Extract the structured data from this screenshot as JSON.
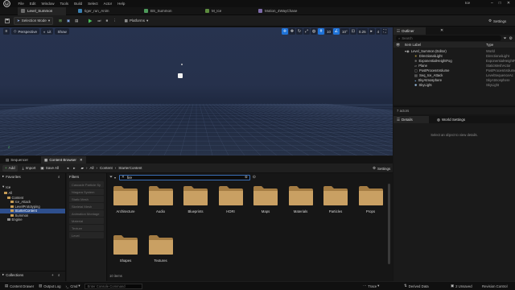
{
  "menu": {
    "items": [
      "File",
      "Edit",
      "Window",
      "Tools",
      "Build",
      "Select",
      "Actor",
      "Help"
    ]
  },
  "window": {
    "project": "Ice"
  },
  "tabs": [
    {
      "label": "Level_Summon",
      "active": true
    },
    {
      "label": "tiger_run_Anim",
      "active": false
    },
    {
      "label": "BS_Summon",
      "active": false
    },
    {
      "label": "M_Ice",
      "active": false
    },
    {
      "label": "Motion_4WayChase",
      "active": false
    }
  ],
  "toolbar": {
    "selection_mode": "Selection Mode",
    "platforms": "Platforms",
    "settings": "Settings"
  },
  "viewport": {
    "perspective": "Perspective",
    "lit": "Lit",
    "show": "Show",
    "grid_snap": "10",
    "rotation_snap": "10°",
    "scale_snap": "0.25",
    "camera_speed": "4",
    "axis_label": "Z"
  },
  "outliner": {
    "tab": "Outliner",
    "search_placeholder": "Search",
    "col_label": "Item Label",
    "col_type": "Type",
    "rows": [
      {
        "label": "Level_Summon (Editor)",
        "type": "World"
      },
      {
        "label": "DirectionalLight",
        "type": "DirectionalLight"
      },
      {
        "label": "ExponentialHeightFog",
        "type": "ExponentialHeightF"
      },
      {
        "label": "Plane",
        "type": "StaticMeshActor"
      },
      {
        "label": "PostProcessVolume",
        "type": "PostProcessVolume"
      },
      {
        "label": "Seq_Ice_Attack",
        "type": "LevelSequenceAc"
      },
      {
        "label": "SkyAtmosphere",
        "type": "SkyAtmosphere"
      },
      {
        "label": "SkyLight",
        "type": "SkyLight"
      }
    ],
    "actors_count": "7 actors"
  },
  "details": {
    "tab": "Details",
    "tab2": "World Settings",
    "empty": "Select an object to view details."
  },
  "content_browser": {
    "tab_sequencer": "Sequencer",
    "tab_browser": "Content Browser",
    "add": "Add",
    "import": "Import",
    "save_all": "Save All",
    "path": [
      "All",
      "Content",
      "StarterContent"
    ],
    "settings": "Settings",
    "favorites": "Favorites",
    "project": "Ice",
    "tree": [
      {
        "label": "All",
        "depth": 0,
        "selected": false
      },
      {
        "label": "Content",
        "depth": 1,
        "selected": false
      },
      {
        "label": "Ice_Attack",
        "depth": 2,
        "selected": false
      },
      {
        "label": "LevelPrototyping",
        "depth": 2,
        "selected": false
      },
      {
        "label": "StarterContent",
        "depth": 2,
        "selected": true
      },
      {
        "label": "Summon",
        "depth": 2,
        "selected": false
      },
      {
        "label": "Engine",
        "depth": 1,
        "selected": false
      }
    ],
    "collections": "Collections",
    "filters_label": "Filters",
    "filters": [
      "Cascade Particle Sy",
      "Niagara System",
      "Static Mesh",
      "Skeletal Mesh",
      "Animation Montage",
      "Material",
      "Texture",
      "Level"
    ],
    "search_value": "fire",
    "assets": [
      "Architecture",
      "Audio",
      "Blueprints",
      "HDRI",
      "Maps",
      "Materials",
      "Particles",
      "Props",
      "Shapes",
      "Textures"
    ],
    "item_count": "10 items"
  },
  "statusbar": {
    "content_drawer": "Content Drawer",
    "output_log": "Output Log",
    "cmd": "Cmd",
    "cmd_placeholder": "Enter Console Command",
    "trace": "Trace",
    "derived_data": "Derived Data",
    "unsaved": "2 Unsaved",
    "revision": "Revision Control"
  },
  "colors": {
    "accent": "#1f73d8",
    "viewport_sky": "#27334f",
    "folder": "#c79d55",
    "selection": "#2e4f8d"
  }
}
